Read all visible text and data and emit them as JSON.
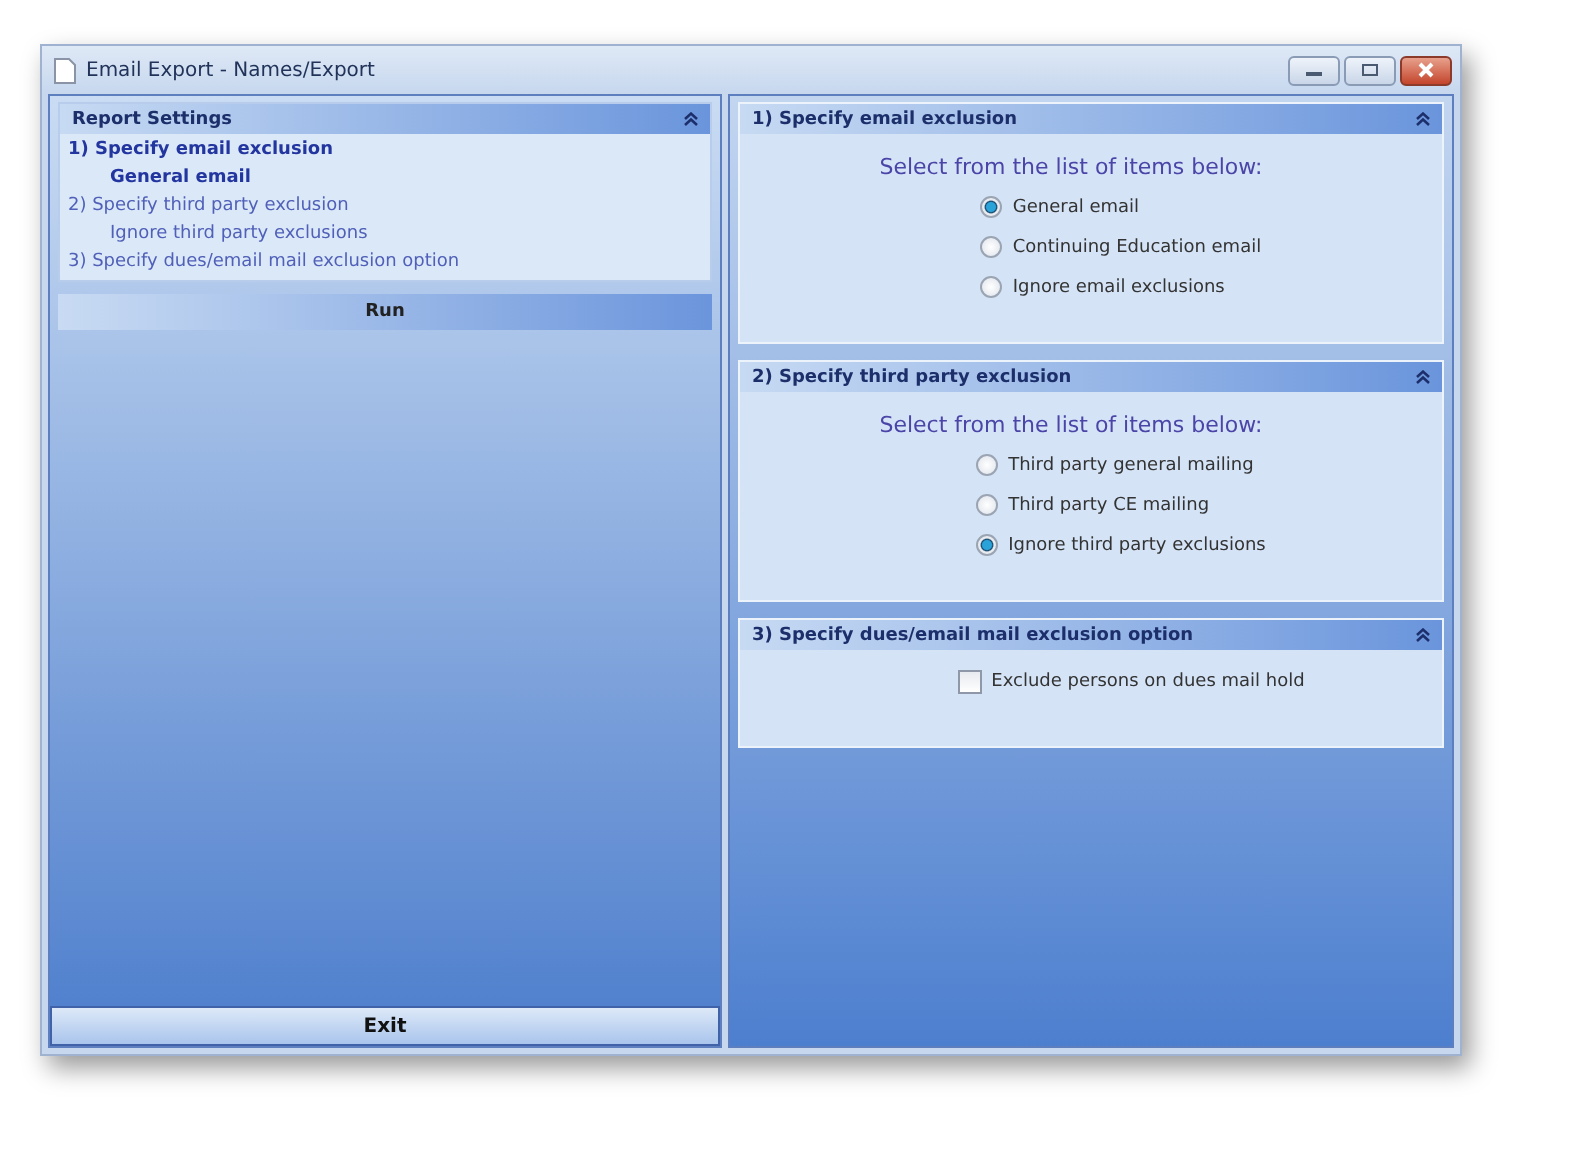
{
  "window": {
    "title": "Email Export - Names/Export"
  },
  "report_settings": {
    "title": "Report Settings",
    "items": [
      {
        "kind": "step",
        "label": "1)  Specify email exclusion",
        "active": true
      },
      {
        "kind": "choice",
        "label": "General email",
        "active": true
      },
      {
        "kind": "step",
        "label": "2) Specify third party exclusion",
        "active": false
      },
      {
        "kind": "choice",
        "label": "Ignore third party exclusions",
        "active": false
      },
      {
        "kind": "step",
        "label": "3) Specify dues/email mail exclusion option",
        "active": false
      }
    ]
  },
  "run_button": "Run",
  "exit_button": "Exit",
  "sections": [
    {
      "title": "1)  Specify email exclusion",
      "kind": "radio",
      "prompt": "Select from the list of items below:",
      "options": [
        {
          "label": "General email",
          "selected": true
        },
        {
          "label": "Continuing Education email",
          "selected": false
        },
        {
          "label": "Ignore email exclusions",
          "selected": false
        }
      ]
    },
    {
      "title": "2)  Specify third party exclusion",
      "kind": "radio",
      "prompt": "Select from the list of items below:",
      "options": [
        {
          "label": "Third party general mailing",
          "selected": false
        },
        {
          "label": "Third party CE mailing",
          "selected": false
        },
        {
          "label": "Ignore third party exclusions",
          "selected": true
        }
      ]
    },
    {
      "title": "3)  Specify dues/email mail exclusion option",
      "kind": "checkbox",
      "options": [
        {
          "label": "Exclude persons on dues mail hold",
          "checked": false
        }
      ]
    }
  ]
}
